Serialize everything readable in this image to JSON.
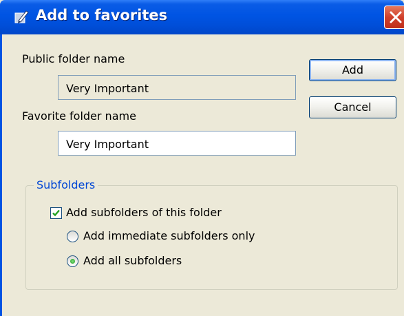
{
  "window": {
    "title": "Add to favorites",
    "icon": "favorites-pen-icon",
    "close_icon": "close-icon"
  },
  "form": {
    "public_folder_label": "Public folder name",
    "public_folder_value": "Very Important",
    "favorite_folder_label": "Favorite folder name",
    "favorite_folder_value": "Very Important"
  },
  "buttons": {
    "add": "Add",
    "cancel": "Cancel"
  },
  "subfolders": {
    "legend": "Subfolders",
    "checkbox_label": "Add subfolders of this folder",
    "checkbox_checked": true,
    "option_immediate": "Add immediate subfolders only",
    "option_all": "Add all subfolders",
    "selected_option": "Add all subfolders"
  },
  "colors": {
    "titlebar": "#0054e3",
    "close_button": "#d0402b",
    "dialog_background": "#ece9d8",
    "group_legend": "#0046d5"
  }
}
